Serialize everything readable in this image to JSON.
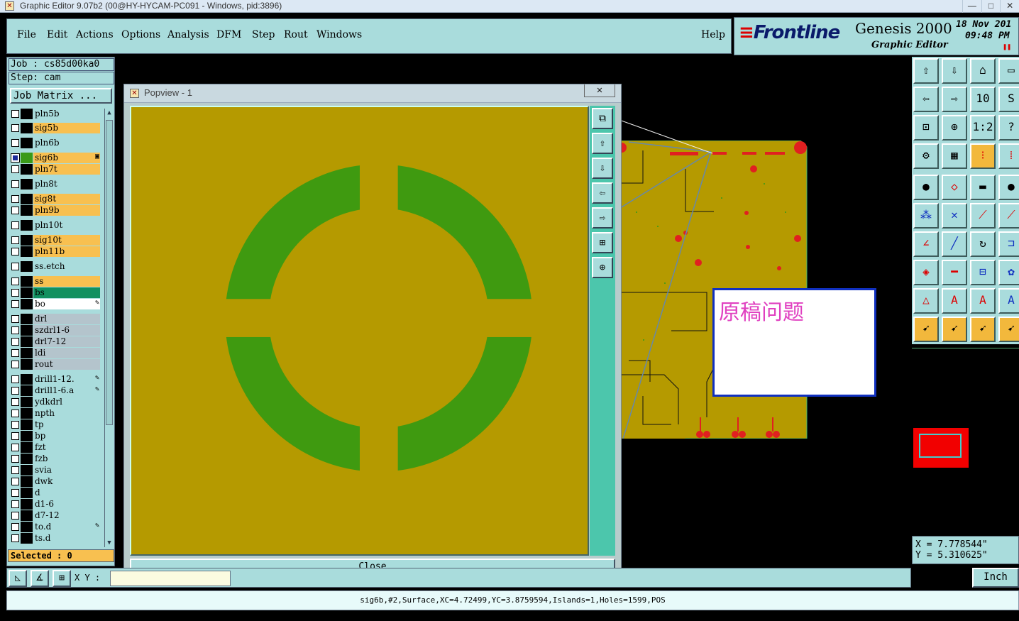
{
  "window": {
    "title": "Graphic Editor 9.07b2 (00@HY-HYCAM-PC091 - Windows, pid:3896)",
    "controls": [
      "—",
      "□",
      "✕"
    ]
  },
  "menu": {
    "items": [
      "File",
      "Edit",
      "Actions",
      "Options",
      "Analysis",
      "DFM",
      "Step",
      "Rout",
      "Windows"
    ],
    "help": "Help"
  },
  "brand": {
    "logo": "Frontline",
    "product": "Genesis 2000",
    "subtitle": "Graphic Editor",
    "date": "18 Nov 201",
    "time": "09:48 PM"
  },
  "job": {
    "job_label": "Job  : cs85d00ka0",
    "step_label": "Step: cam",
    "matrix_button": "Job Matrix ..."
  },
  "layers": [
    {
      "name": "pln5b",
      "color": "cyan"
    },
    {
      "name": "sig5b",
      "color": "orange"
    },
    {
      "name": "pln6b",
      "color": "cyan"
    },
    {
      "name": "sig6b",
      "color": "orange",
      "active": true,
      "marker": "▣"
    },
    {
      "name": "pln7t",
      "color": "orange"
    },
    {
      "name": "pln8t",
      "color": "cyan"
    },
    {
      "name": "sig8t",
      "color": "orange"
    },
    {
      "name": "pln9b",
      "color": "orange"
    },
    {
      "name": "pln10t",
      "color": "cyan"
    },
    {
      "name": "sig10t",
      "color": "orange"
    },
    {
      "name": "pln11b",
      "color": "orange"
    },
    {
      "name": "ss.etch",
      "color": "cyan"
    },
    {
      "name": "ss",
      "color": "orange"
    },
    {
      "name": "bs",
      "color": "green"
    },
    {
      "name": "bo",
      "color": "white",
      "marker": "✎"
    },
    {
      "name": "drl",
      "color": "gray"
    },
    {
      "name": "szdrl1-6",
      "color": "gray"
    },
    {
      "name": "drl7-12",
      "color": "gray"
    },
    {
      "name": "ldi",
      "color": "gray"
    },
    {
      "name": "rout",
      "color": "gray"
    },
    {
      "name": "drill1-12.",
      "color": "cyan",
      "marker": "✎"
    },
    {
      "name": "drill1-6.a",
      "color": "cyan",
      "marker": "✎"
    },
    {
      "name": "ydkdrl",
      "color": "cyan"
    },
    {
      "name": "npth",
      "color": "cyan"
    },
    {
      "name": "tp",
      "color": "cyan"
    },
    {
      "name": "bp",
      "color": "cyan"
    },
    {
      "name": "fzt",
      "color": "cyan"
    },
    {
      "name": "fzb",
      "color": "cyan"
    },
    {
      "name": "svia",
      "color": "cyan"
    },
    {
      "name": "dwk",
      "color": "cyan"
    },
    {
      "name": "d",
      "color": "cyan"
    },
    {
      "name": "d1-6",
      "color": "cyan"
    },
    {
      "name": "d7-12",
      "color": "cyan"
    },
    {
      "name": "to.d",
      "color": "cyan",
      "marker": "✎"
    },
    {
      "name": "ts.d",
      "color": "cyan"
    }
  ],
  "selected": "Selected : 0",
  "xy": {
    "label": "X Y :",
    "value": ""
  },
  "units_button": "Inch",
  "coordinates": {
    "x": "X = 7.778544\"",
    "y": "Y = 5.310625\""
  },
  "status": "sig6b,#2,Surface,XC=4.72499,YC=3.8759594,Islands=1,Holes=1599,POS",
  "popview": {
    "title": "Popview - 1",
    "close_x": "✕",
    "close_button": "Close"
  },
  "note": {
    "text": "原稿问题"
  },
  "colors": {
    "panel": "#a9dcdc",
    "popview_bg": "#b59a00",
    "ring": "#3f9a10",
    "board": "#b59a00",
    "accent_orange": "#f8c050",
    "highlight_red": "#f20000"
  }
}
